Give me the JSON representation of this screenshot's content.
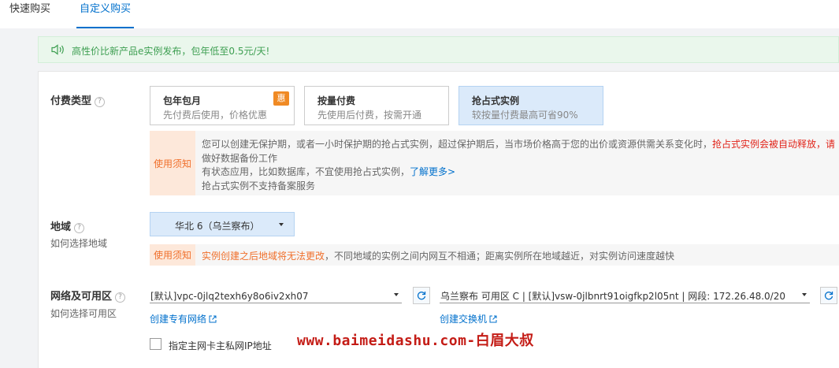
{
  "tabs": [
    {
      "label": "快速购买"
    },
    {
      "label": "自定义购买"
    }
  ],
  "notice": {
    "text": "高性价比新产品e实例发布，包年低至0.5元/天!"
  },
  "billing": {
    "label": "付费类型",
    "options": [
      {
        "title": "包年包月",
        "desc": "先付费后使用，价格优惠",
        "badge": "惠"
      },
      {
        "title": "按量付费",
        "desc": "先使用后付费，按需开通"
      },
      {
        "title": "抢占式实例",
        "desc": "较按量付费最高可省90%"
      }
    ],
    "notice": {
      "tag": "使用须知",
      "line1_normal": "您可以创建无保护期，或者一小时保护期的抢占式实例，超过保护期后，当市场价格高于您的出价或资源供需关系变化时，",
      "line1_red": "抢占式实例会被自动释放，请",
      "line2_red": "做好数据备份工作",
      "line3_normal": "有状态应用，比如数据库，不宜使用抢占式实例，",
      "line3_link": "了解更多>",
      "line4": "抢占式实例不支持备案服务"
    }
  },
  "region": {
    "label": "地域",
    "sublabel": "如何选择地域",
    "selected": "华北 6（乌兰察布）",
    "notice": {
      "tag": "使用须知",
      "orange": "实例创建之后地域将无法更改",
      "normal": "，不同地域的实例之间内网互不相通；距离实例所在地域越近，对实例访问速度越快"
    }
  },
  "network": {
    "label": "网络及可用区",
    "sublabel": "如何选择可用区",
    "vpc_value": "[默认]vpc-0jlq2texh6y8o6iv2xh07",
    "vsw_value": "乌兰察布 可用区 C | [默认]vsw-0jlbnrt91oigfkp2l05nt | 网段: 172.26.48.0/20",
    "create_vpc": "创建专有网络",
    "create_vsw": "创建交换机",
    "checkbox_label": "指定主网卡主私网IP地址"
  },
  "watermark": "www.baimeidashu.com-白眉大叔",
  "colors": {
    "accent": "#0070cc",
    "warning": "#e1261c",
    "notice_green": "#3e9f52",
    "badge": "#f08a24"
  }
}
